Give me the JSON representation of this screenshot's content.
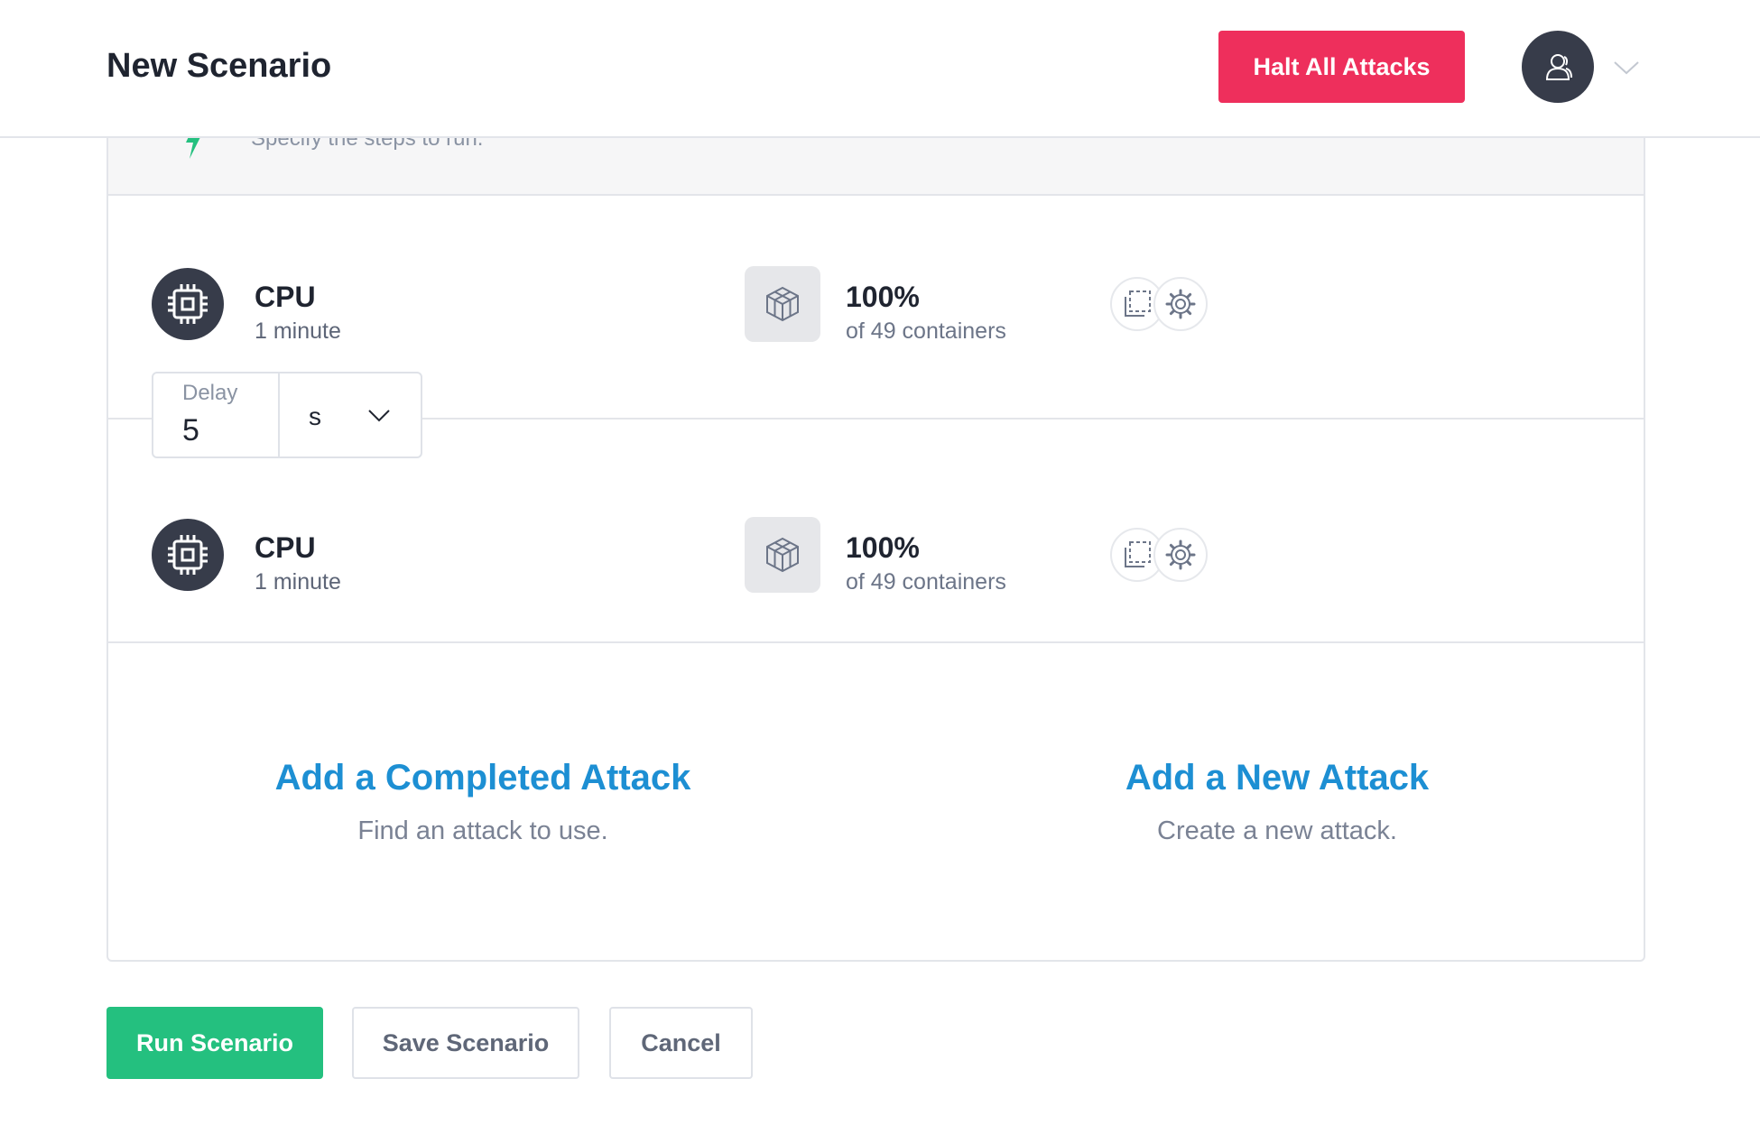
{
  "header": {
    "title": "New Scenario",
    "halt_label": "Halt All Attacks"
  },
  "steps_intro": {
    "text": "Specify the steps to run."
  },
  "steps": [
    {
      "attack_name": "CPU",
      "length": "1 minute",
      "magnitude": "100%",
      "target_count": "of 49 containers"
    },
    {
      "attack_name": "CPU",
      "length": "1 minute",
      "magnitude": "100%",
      "target_count": "of 49 containers"
    }
  ],
  "delay": {
    "label": "Delay",
    "value": "5",
    "unit": "s"
  },
  "add": {
    "completed_title": "Add a Completed Attack",
    "completed_sub": "Find an attack to use.",
    "new_title": "Add a New Attack",
    "new_sub": "Create a new attack."
  },
  "footer": {
    "run_label": "Run Scenario",
    "save_label": "Save Scenario",
    "cancel_label": "Cancel"
  },
  "colors": {
    "accent_blue": "#1d8fd3",
    "run_green": "#24c07f",
    "halt_red": "#ee2f5c",
    "dark_icon": "#373c4a"
  },
  "icons": {
    "attack": "cpu-chip-icon",
    "target": "container-cube-icon",
    "action_1": "copy-icon",
    "action_2": "gear-icon",
    "avatar": "user-icon",
    "dropdown": "chevron-down-icon"
  }
}
